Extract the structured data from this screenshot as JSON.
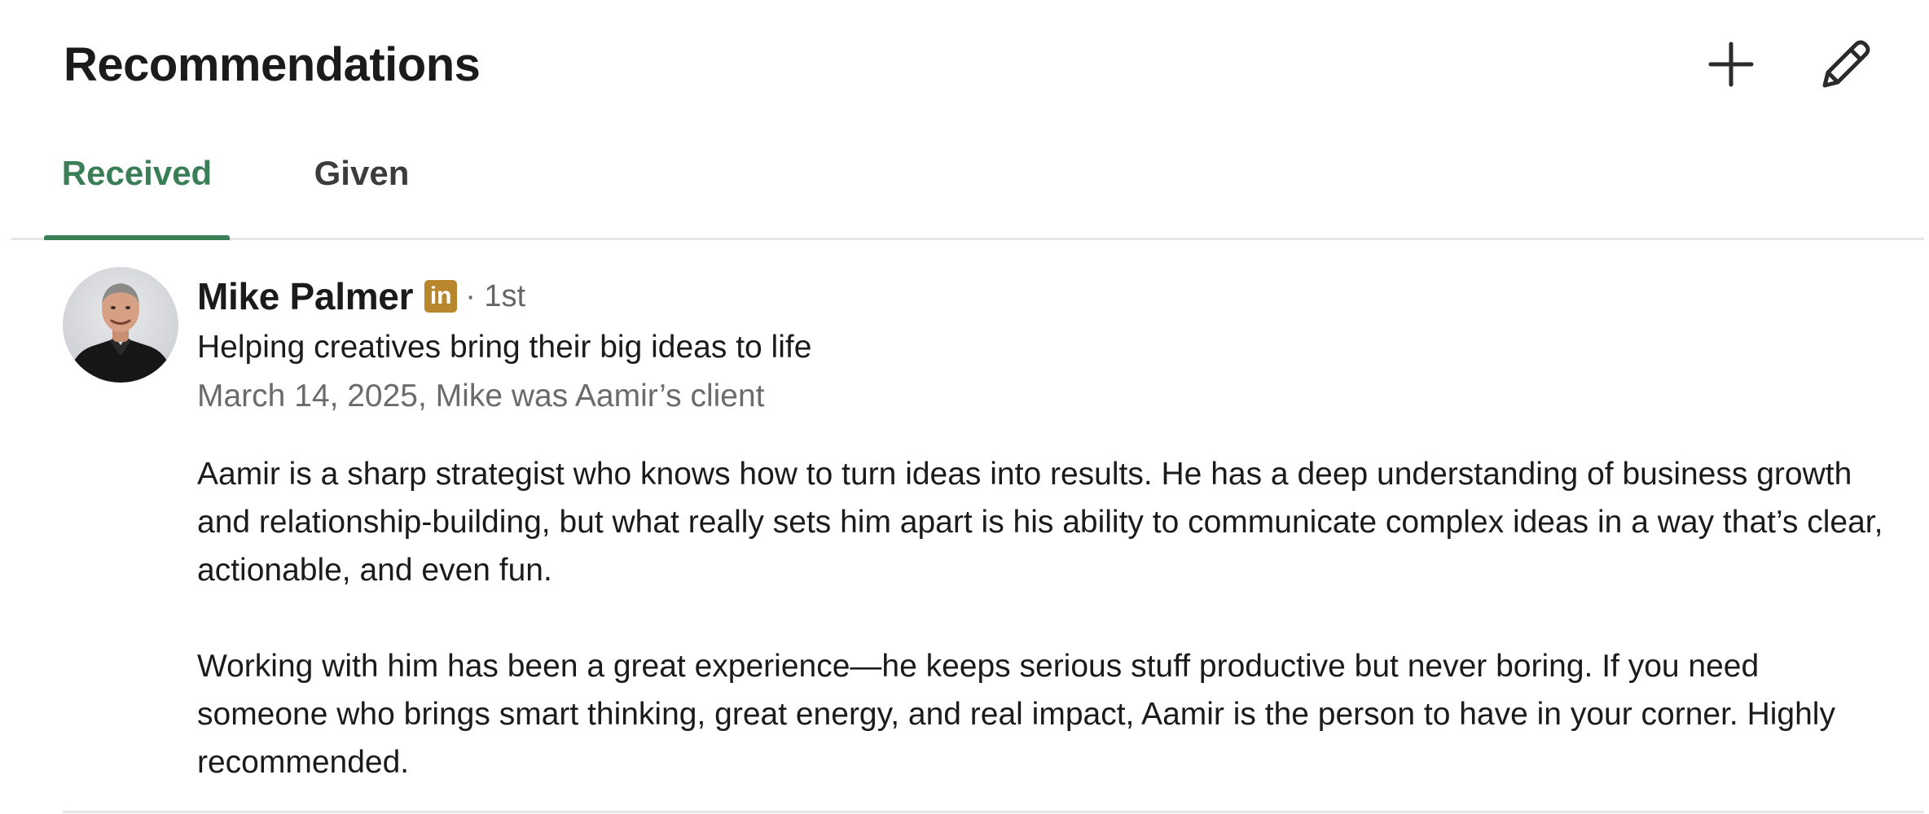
{
  "header": {
    "title": "Recommendations",
    "add_icon": "plus-icon",
    "edit_icon": "pencil-icon"
  },
  "tabs": [
    {
      "label": "Received",
      "active": true
    },
    {
      "label": "Given",
      "active": false
    }
  ],
  "recommendation": {
    "name": "Mike Palmer",
    "badge_icon": "linkedin-icon",
    "badge_text": "in",
    "degree": "· 1st",
    "headline": "Helping creatives bring their big ideas to life",
    "meta": "March 14, 2025, Mike was Aamir’s client",
    "paragraphs": [
      "Aamir is a sharp strategist who knows how to turn ideas into results. He has a deep understanding of business growth and relationship-building, but what really sets him apart is his ability to communicate complex ideas in a way that’s clear, actionable, and even fun.",
      "Working with him has been a great experience—he keeps serious stuff productive but never boring. If you need someone who brings smart thinking, great energy, and real impact, Aamir is the person to have in your corner. Highly recommended."
    ]
  },
  "colors": {
    "accent_green": "#3a7e57",
    "badge_gold": "#b8862c",
    "divider": "#e6e6e6",
    "muted_text": "#6b6b6b"
  }
}
